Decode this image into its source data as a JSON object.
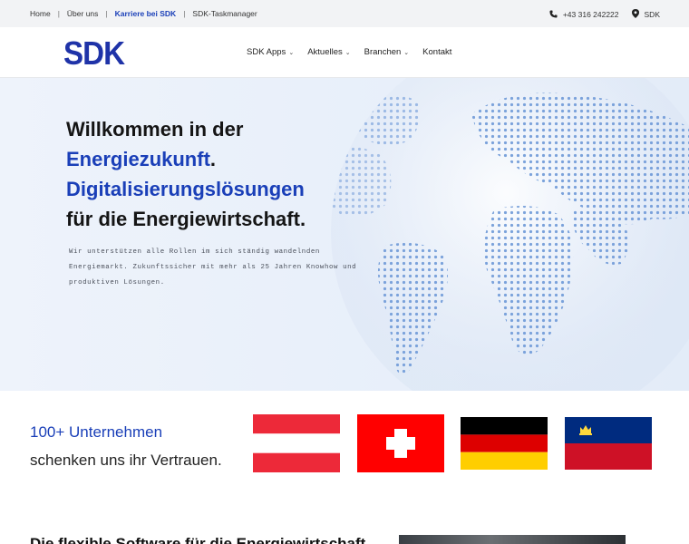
{
  "topbar": {
    "links": [
      "Home",
      "Über uns",
      "Karriere bei SDK",
      "SDK-Taskmanager"
    ],
    "phone": "+43 316 242222",
    "location": "SDK"
  },
  "header": {
    "logo": "SDK",
    "nav": [
      {
        "label": "SDK Apps",
        "dropdown": true
      },
      {
        "label": "Aktuelles",
        "dropdown": true
      },
      {
        "label": "Branchen",
        "dropdown": true
      },
      {
        "label": "Kontakt",
        "dropdown": false
      }
    ]
  },
  "hero": {
    "line1": "Willkommen in der",
    "line2": "Energiezukunft",
    "line2_dot": ".",
    "line3": "Digitalisierungslösungen",
    "line4": "für die Energiewirtschaft.",
    "text": "Wir unterstützen alle Rollen im sich ständig wandelnden Energiemarkt. Zukunftssicher mit mehr als 25 Jahren Knowhow und produktiven Lösungen."
  },
  "trust": {
    "count": "100+ Unternehmen",
    "text": "schenken uns ihr Vertrauen.",
    "flags": [
      "austria-flag",
      "switzerland-flag",
      "germany-flag",
      "liechtenstein-flag"
    ]
  },
  "bottom": {
    "heading": "Die flexible Software für die Energiewirtschaft"
  },
  "colors": {
    "brand": "#1f33a8",
    "accent": "#1a3fb8",
    "hero_bg": "#e9f0fa",
    "topbar_bg": "#f2f3f5"
  }
}
